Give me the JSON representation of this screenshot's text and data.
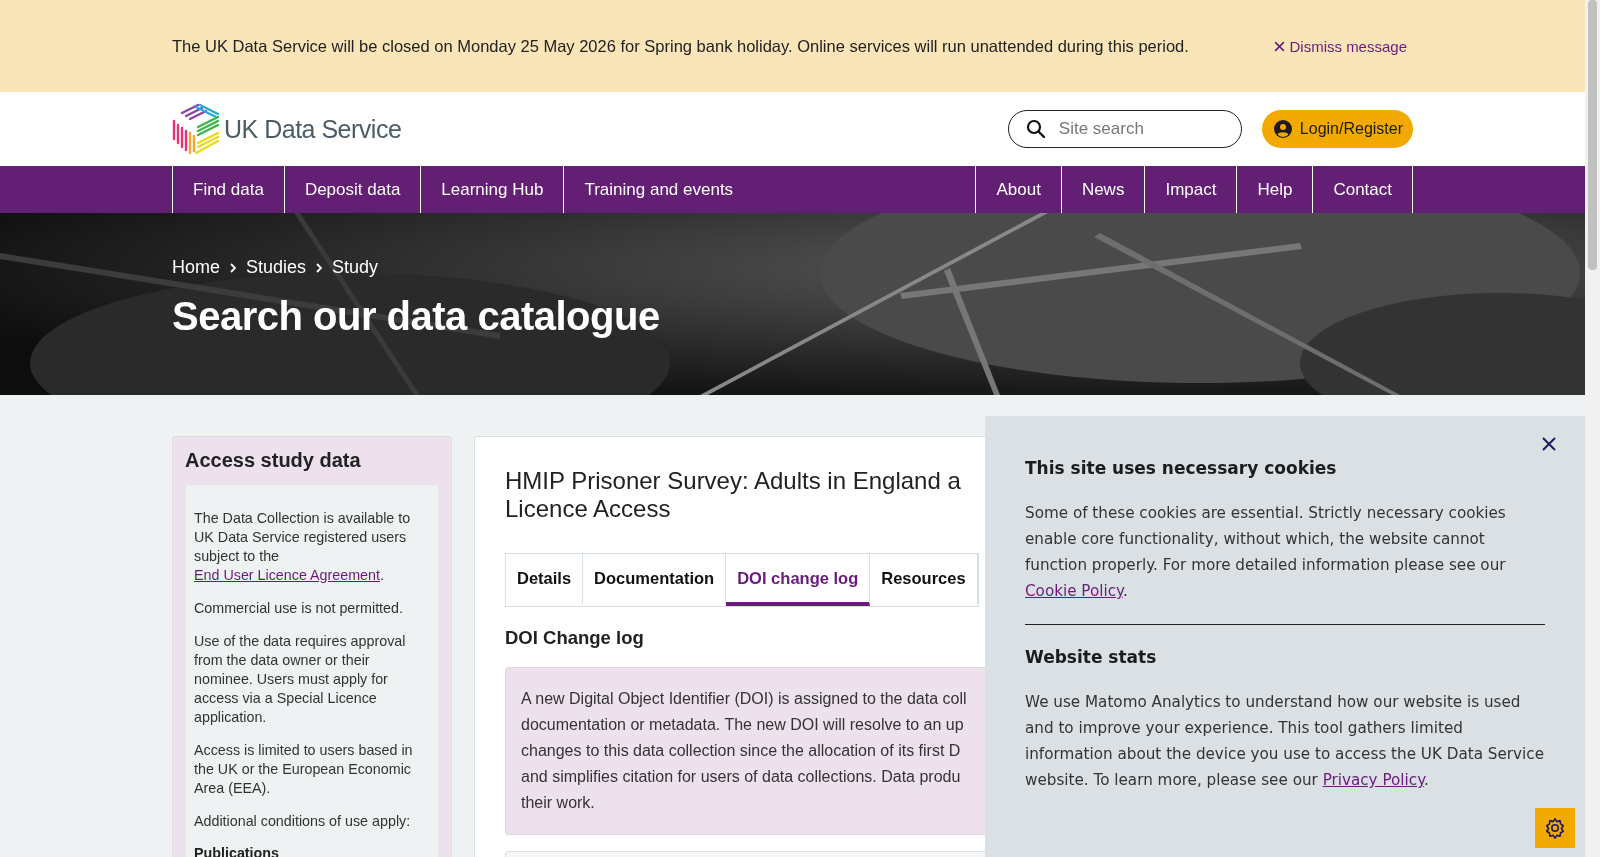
{
  "notice": {
    "text": "The UK Data Service will be closed on Monday 25 May 2026 for Spring bank holiday. Online services will run unattended during this period.",
    "dismiss": "Dismiss message"
  },
  "header": {
    "logo_text": "UK Data Service",
    "search": {
      "placeholder": "Site search"
    },
    "login": "Login/Register"
  },
  "nav": {
    "left": [
      {
        "label": "Find data"
      },
      {
        "label": "Deposit data"
      },
      {
        "label": "Learning Hub"
      },
      {
        "label": "Training and events"
      }
    ],
    "right": [
      {
        "label": "About"
      },
      {
        "label": "News"
      },
      {
        "label": "Impact"
      },
      {
        "label": "Help"
      },
      {
        "label": "Contact"
      }
    ]
  },
  "hero": {
    "kind": "picture",
    "breadcrumbs": [
      "Home",
      "Studies",
      "Study"
    ],
    "title": "Search our data catalogue"
  },
  "sidebar": {
    "title": "Access study data",
    "paragraphs": [
      {
        "text": "The Data Collection is available to UK Data Service registered users subject to the ",
        "link": "End User Licence Agreement",
        "after": "."
      },
      {
        "text": "Commercial use is not permitted."
      },
      {
        "text": "Use of the data requires approval from the data owner or their nominee. Users must apply for access via a Special Licence application."
      },
      {
        "text": "Access is limited to users based in the UK or the European Economic Area (EEA)."
      },
      {
        "text": "Additional conditions of use apply:"
      }
    ],
    "subheading": "Publications"
  },
  "study": {
    "title_lines": [
      "HMIP Prisoner Survey: Adults in England a",
      "Licence Access"
    ],
    "tabs": [
      {
        "label": "Details",
        "selected": false
      },
      {
        "label": "Documentation",
        "selected": false
      },
      {
        "label": "DOI change log",
        "selected": true
      },
      {
        "label": "Resources",
        "selected": false
      }
    ],
    "section_heading": "DOI Change log",
    "info_lines": [
      "A new Digital Object Identifier (DOI) is assigned to the data coll",
      "documentation or metadata. The new DOI will resolve to an up",
      "changes to this data collection since the allocation of its first D",
      "and simplifies citation for users of data collections. Data produ",
      "their work."
    ]
  },
  "cookies": {
    "sections": [
      {
        "heading": "This site uses necessary cookies",
        "text": "Some of these cookies are essential. Strictly necessary cookies enable core functionality, without which, the website cannot function properly. For more detailed information please see our ",
        "link": "Cookie Policy",
        "after": "."
      },
      {
        "heading": "Website stats",
        "text": "We use Matomo Analytics to understand how our website is used and to improve your experience. This tool gathers limited information about the device you use to access the UK Data Service website. To learn more, please see our ",
        "link": "Privacy Policy",
        "after": "."
      }
    ]
  }
}
